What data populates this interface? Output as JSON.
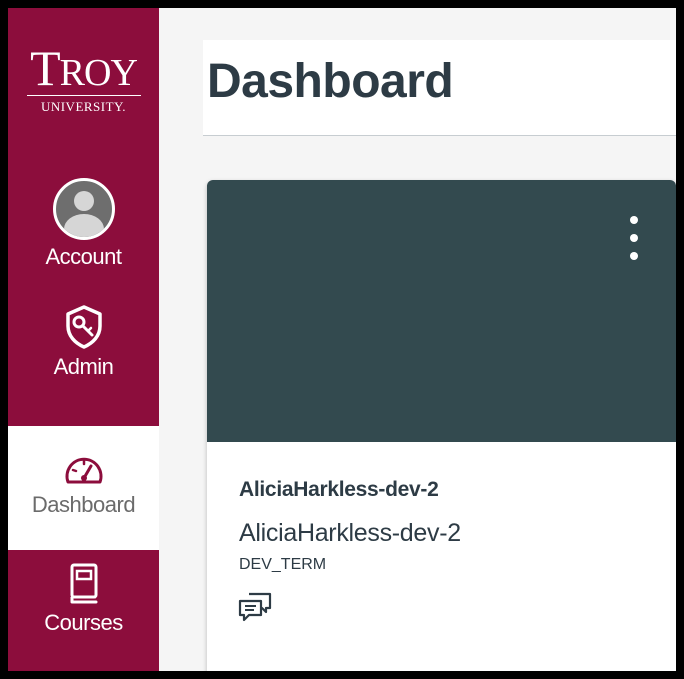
{
  "brand": {
    "logo_word_first": "T",
    "logo_word_rest": "ROY",
    "logo_sub": "UNIVERSITY."
  },
  "nav": {
    "items": [
      {
        "label": "Account",
        "icon": "user-avatar-icon"
      },
      {
        "label": "Admin",
        "icon": "admin-shield-icon"
      },
      {
        "label": "Dashboard",
        "icon": "dashboard-gauge-icon",
        "active": true
      },
      {
        "label": "Courses",
        "icon": "book-icon"
      }
    ]
  },
  "page": {
    "title": "Dashboard"
  },
  "card": {
    "title": "AliciaHarkless-dev-2",
    "subtitle": "AliciaHarkless-dev-2",
    "term": "DEV_TERM",
    "options_icon": "kebab-menu-icon",
    "discussions_icon": "discussions-icon"
  },
  "colors": {
    "nav_bg": "#8c0d3c",
    "card_hero": "#334a4f",
    "text_dark": "#2d3b45",
    "content_bg": "#f5f5f5"
  }
}
